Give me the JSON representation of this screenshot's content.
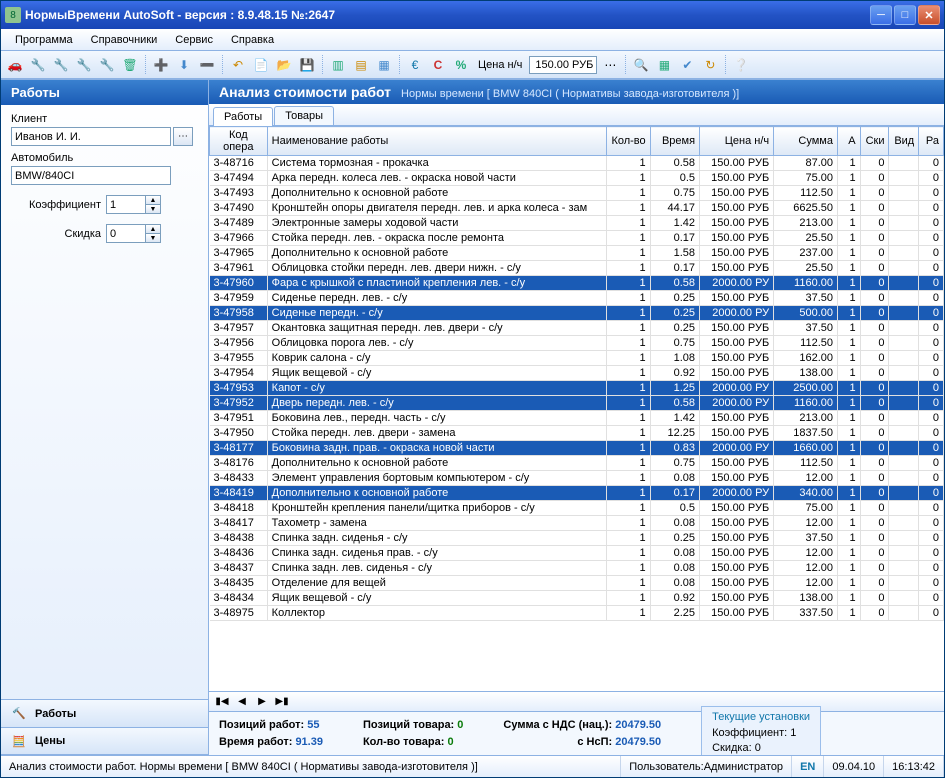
{
  "title": "НормыВремени AutoSoft  - версия : 8.9.48.15   №:2647",
  "menu": [
    "Программа",
    "Справочники",
    "Сервис",
    "Справка"
  ],
  "toolbar": {
    "price_label": "Цена н/ч",
    "price_value": "150.00 РУБ",
    "cur": "€",
    "c": "С",
    "pct": "%"
  },
  "sidebar": {
    "header": "Работы",
    "labels": {
      "client": "Клиент",
      "auto": "Автомобиль",
      "coef": "Коэффициент",
      "discount": "Скидка"
    },
    "client_value": "Иванов И. И.",
    "auto_value": "BMW/840CI",
    "coef_value": "1",
    "discount_value": "0",
    "nav": [
      {
        "label": "Работы"
      },
      {
        "label": "Цены"
      }
    ]
  },
  "main": {
    "title": "Анализ стоимости работ",
    "subtitle": "Нормы времени [ BMW 840CI ( Нормативы завода-изготовителя )]",
    "tabs": [
      "Работы",
      "Товары"
    ]
  },
  "grid": {
    "headers": [
      "Код опера",
      "Наименование работы",
      "Кол-во",
      "Время",
      "Цена н/ч",
      "Сумма",
      "А",
      "Ски",
      "Вид",
      "Ра"
    ],
    "rows": [
      {
        "c": "3-48716",
        "n": "Система тормозная - прокачка",
        "q": "1",
        "t": "0.58",
        "p": "150.00 РУБ",
        "s": "87.00",
        "a": "1",
        "ski": "0",
        "vid": "",
        "ra": "0",
        "sel": 0
      },
      {
        "c": "3-47494",
        "n": "Арка передн. колеса лев. - окраска новой части",
        "q": "1",
        "t": "0.5",
        "p": "150.00 РУБ",
        "s": "75.00",
        "a": "1",
        "ski": "0",
        "vid": "",
        "ra": "0",
        "sel": 0
      },
      {
        "c": "3-47493",
        "n": "Дополнительно к основной работе",
        "q": "1",
        "t": "0.75",
        "p": "150.00 РУБ",
        "s": "112.50",
        "a": "1",
        "ski": "0",
        "vid": "",
        "ra": "0",
        "sel": 0
      },
      {
        "c": "3-47490",
        "n": "Кронштейн опоры двигателя передн. лев. и арка колеса - зам",
        "q": "1",
        "t": "44.17",
        "p": "150.00 РУБ",
        "s": "6625.50",
        "a": "1",
        "ski": "0",
        "vid": "",
        "ra": "0",
        "sel": 0
      },
      {
        "c": "3-47489",
        "n": "Электронные замеры ходовой части",
        "q": "1",
        "t": "1.42",
        "p": "150.00 РУБ",
        "s": "213.00",
        "a": "1",
        "ski": "0",
        "vid": "",
        "ra": "0",
        "sel": 0
      },
      {
        "c": "3-47966",
        "n": "Стойка передн. лев. - окраска после ремонта",
        "q": "1",
        "t": "0.17",
        "p": "150.00 РУБ",
        "s": "25.50",
        "a": "1",
        "ski": "0",
        "vid": "",
        "ra": "0",
        "sel": 0
      },
      {
        "c": "3-47965",
        "n": "Дополнительно к основной работе",
        "q": "1",
        "t": "1.58",
        "p": "150.00 РУБ",
        "s": "237.00",
        "a": "1",
        "ski": "0",
        "vid": "",
        "ra": "0",
        "sel": 0
      },
      {
        "c": "3-47961",
        "n": "Облицовка стойки передн. лев. двери нижн. - с/у",
        "q": "1",
        "t": "0.17",
        "p": "150.00 РУБ",
        "s": "25.50",
        "a": "1",
        "ski": "0",
        "vid": "",
        "ra": "0",
        "sel": 0
      },
      {
        "c": "3-47960",
        "n": "Фара с крышкой с пластиной крепления лев. - с/у",
        "q": "1",
        "t": "0.58",
        "p": "2000.00 РУ",
        "s": "1160.00",
        "a": "1",
        "ski": "0",
        "vid": "",
        "ra": "0",
        "sel": 1
      },
      {
        "c": "3-47959",
        "n": "Сиденье передн. лев. - с/у",
        "q": "1",
        "t": "0.25",
        "p": "150.00 РУБ",
        "s": "37.50",
        "a": "1",
        "ski": "0",
        "vid": "",
        "ra": "0",
        "sel": 0
      },
      {
        "c": "3-47958",
        "n": "Сиденье передн. - с/у",
        "q": "1",
        "t": "0.25",
        "p": "2000.00 РУ",
        "s": "500.00",
        "a": "1",
        "ski": "0",
        "vid": "",
        "ra": "0",
        "sel": 1
      },
      {
        "c": "3-47957",
        "n": "Окантовка защитная передн. лев. двери - с/у",
        "q": "1",
        "t": "0.25",
        "p": "150.00 РУБ",
        "s": "37.50",
        "a": "1",
        "ski": "0",
        "vid": "",
        "ra": "0",
        "sel": 0
      },
      {
        "c": "3-47956",
        "n": "Облицовка порога лев. - с/у",
        "q": "1",
        "t": "0.75",
        "p": "150.00 РУБ",
        "s": "112.50",
        "a": "1",
        "ski": "0",
        "vid": "",
        "ra": "0",
        "sel": 0
      },
      {
        "c": "3-47955",
        "n": "Коврик салона - с/у",
        "q": "1",
        "t": "1.08",
        "p": "150.00 РУБ",
        "s": "162.00",
        "a": "1",
        "ski": "0",
        "vid": "",
        "ra": "0",
        "sel": 0
      },
      {
        "c": "3-47954",
        "n": "Ящик вещевой - с/у",
        "q": "1",
        "t": "0.92",
        "p": "150.00 РУБ",
        "s": "138.00",
        "a": "1",
        "ski": "0",
        "vid": "",
        "ra": "0",
        "sel": 0
      },
      {
        "c": "3-47953",
        "n": "Капот - с/у",
        "q": "1",
        "t": "1.25",
        "p": "2000.00 РУ",
        "s": "2500.00",
        "a": "1",
        "ski": "0",
        "vid": "",
        "ra": "0",
        "sel": 1
      },
      {
        "c": "3-47952",
        "n": "Дверь передн. лев. - с/у",
        "q": "1",
        "t": "0.58",
        "p": "2000.00 РУ",
        "s": "1160.00",
        "a": "1",
        "ski": "0",
        "vid": "",
        "ra": "0",
        "sel": 1
      },
      {
        "c": "3-47951",
        "n": "Боковина лев., передн. часть - с/у",
        "q": "1",
        "t": "1.42",
        "p": "150.00 РУБ",
        "s": "213.00",
        "a": "1",
        "ski": "0",
        "vid": "",
        "ra": "0",
        "sel": 0
      },
      {
        "c": "3-47950",
        "n": "Стойка передн. лев. двери - замена",
        "q": "1",
        "t": "12.25",
        "p": "150.00 РУБ",
        "s": "1837.50",
        "a": "1",
        "ski": "0",
        "vid": "",
        "ra": "0",
        "sel": 0
      },
      {
        "c": "3-48177",
        "n": "Боковина задн. прав. - окраска новой части",
        "q": "1",
        "t": "0.83",
        "p": "2000.00 РУ",
        "s": "1660.00",
        "a": "1",
        "ski": "0",
        "vid": "",
        "ra": "0",
        "sel": 1
      },
      {
        "c": "3-48176",
        "n": "Дополнительно к основной работе",
        "q": "1",
        "t": "0.75",
        "p": "150.00 РУБ",
        "s": "112.50",
        "a": "1",
        "ski": "0",
        "vid": "",
        "ra": "0",
        "sel": 0
      },
      {
        "c": "3-48433",
        "n": "Элемент управления бортовым компьютером - с/у",
        "q": "1",
        "t": "0.08",
        "p": "150.00 РУБ",
        "s": "12.00",
        "a": "1",
        "ski": "0",
        "vid": "",
        "ra": "0",
        "sel": 0
      },
      {
        "c": "3-48419",
        "n": "Дополнительно к основной работе",
        "q": "1",
        "t": "0.17",
        "p": "2000.00 РУ",
        "s": "340.00",
        "a": "1",
        "ski": "0",
        "vid": "",
        "ra": "0",
        "sel": 1
      },
      {
        "c": "3-48418",
        "n": "Кронштейн крепления панели/щитка приборов - с/у",
        "q": "1",
        "t": "0.5",
        "p": "150.00 РУБ",
        "s": "75.00",
        "a": "1",
        "ski": "0",
        "vid": "",
        "ra": "0",
        "sel": 0
      },
      {
        "c": "3-48417",
        "n": "Тахометр - замена",
        "q": "1",
        "t": "0.08",
        "p": "150.00 РУБ",
        "s": "12.00",
        "a": "1",
        "ski": "0",
        "vid": "",
        "ra": "0",
        "sel": 0
      },
      {
        "c": "3-48438",
        "n": "Спинка задн. сиденья - с/у",
        "q": "1",
        "t": "0.25",
        "p": "150.00 РУБ",
        "s": "37.50",
        "a": "1",
        "ski": "0",
        "vid": "",
        "ra": "0",
        "sel": 0
      },
      {
        "c": "3-48436",
        "n": "Спинка задн. сиденья прав. - с/у",
        "q": "1",
        "t": "0.08",
        "p": "150.00 РУБ",
        "s": "12.00",
        "a": "1",
        "ski": "0",
        "vid": "",
        "ra": "0",
        "sel": 0
      },
      {
        "c": "3-48437",
        "n": "Спинка задн. лев. сиденья - с/у",
        "q": "1",
        "t": "0.08",
        "p": "150.00 РУБ",
        "s": "12.00",
        "a": "1",
        "ski": "0",
        "vid": "",
        "ra": "0",
        "sel": 0
      },
      {
        "c": "3-48435",
        "n": "Отделение для вещей",
        "q": "1",
        "t": "0.08",
        "p": "150.00 РУБ",
        "s": "12.00",
        "a": "1",
        "ski": "0",
        "vid": "",
        "ra": "0",
        "sel": 0
      },
      {
        "c": "3-48434",
        "n": "Ящик вещевой - с/у",
        "q": "1",
        "t": "0.92",
        "p": "150.00 РУБ",
        "s": "138.00",
        "a": "1",
        "ski": "0",
        "vid": "",
        "ra": "0",
        "sel": 0
      },
      {
        "c": "3-48975",
        "n": "Коллектор",
        "q": "1",
        "t": "2.25",
        "p": "150.00 РУБ",
        "s": "337.50",
        "a": "1",
        "ski": "0",
        "vid": "",
        "ra": "0",
        "sel": 0
      }
    ]
  },
  "summary": {
    "pos_label": "Позиций работ:",
    "pos_value": "55",
    "time_label": "Время работ:",
    "time_value": "91.39",
    "goods_pos_label": "Позиций товара:",
    "goods_pos_value": "0",
    "goods_qty_label": "Кол-во товара:",
    "goods_qty_value": "0",
    "sum_vat_label": "Сумма с НДС (нац.):",
    "sum_vat_value": "20479.50",
    "nsp_label": "с НсП:",
    "nsp_value": "20479.50",
    "current_title": "Текущие установки",
    "cur_coef_label": "Коэффициент:",
    "cur_coef_value": "1",
    "cur_disc_label": "Скидка:",
    "cur_disc_value": "0"
  },
  "status": {
    "left": "Анализ стоимости работ. Нормы времени [ BMW 840CI ( Нормативы завода-изготовителя )]",
    "user_label": "Пользователь: ",
    "user": "Администратор",
    "lang": "EN",
    "date": "09.04.10",
    "time": "16:13:42"
  }
}
